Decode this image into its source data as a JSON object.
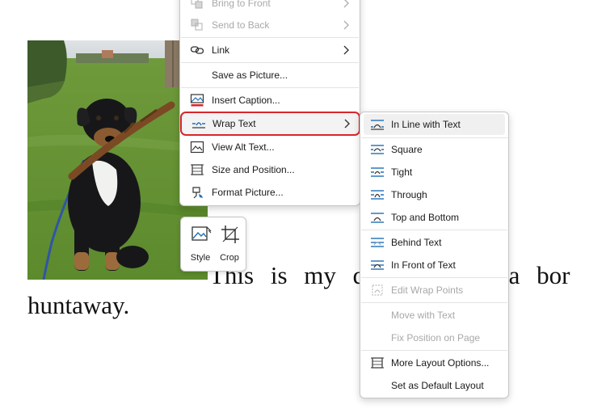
{
  "document": {
    "line1": "This is my do",
    "line1_tail": "e is a bor",
    "line2": "huntaway."
  },
  "context_menu": {
    "items": [
      {
        "label": "Bring to Front",
        "icon": "bring-to-front-icon",
        "submenu": true,
        "disabled": true
      },
      {
        "label": "Send to Back",
        "icon": "send-to-back-icon",
        "submenu": true,
        "disabled": true
      },
      {
        "label": "Link",
        "icon": "link-icon",
        "submenu": true
      },
      {
        "label": "Save as Picture...",
        "icon": ""
      },
      {
        "label": "Insert Caption...",
        "icon": "insert-caption-icon"
      },
      {
        "label": "Wrap Text",
        "icon": "wrap-text-icon",
        "submenu": true,
        "highlighted": true
      },
      {
        "label": "View Alt Text...",
        "icon": "alt-text-icon"
      },
      {
        "label": "Size and Position...",
        "icon": "size-position-icon"
      },
      {
        "label": "Format Picture...",
        "icon": "format-picture-icon"
      }
    ]
  },
  "wrap_submenu": {
    "items": [
      {
        "label": "In Line with Text",
        "icon": "inline-wrap-icon",
        "highlighted": true
      },
      {
        "label": "Square",
        "icon": "square-wrap-icon"
      },
      {
        "label": "Tight",
        "icon": "tight-wrap-icon"
      },
      {
        "label": "Through",
        "icon": "through-wrap-icon"
      },
      {
        "label": "Top and Bottom",
        "icon": "top-bottom-wrap-icon"
      },
      {
        "label": "Behind Text",
        "icon": "behind-text-icon"
      },
      {
        "label": "In Front of Text",
        "icon": "in-front-text-icon"
      },
      {
        "label": "Edit Wrap Points",
        "icon": "edit-wrap-points-icon",
        "disabled": true
      },
      {
        "label": "Move with Text",
        "icon": "",
        "disabled": true
      },
      {
        "label": "Fix Position on Page",
        "icon": "",
        "disabled": true
      },
      {
        "label": "More Layout Options...",
        "icon": "layout-options-icon"
      },
      {
        "label": "Set as Default Layout",
        "icon": ""
      }
    ]
  },
  "mini_toolbar": {
    "style_label": "Style",
    "crop_label": "Crop"
  },
  "colors": {
    "accent_blue": "#1f6fb5",
    "highlight_border": "#d8262b"
  }
}
